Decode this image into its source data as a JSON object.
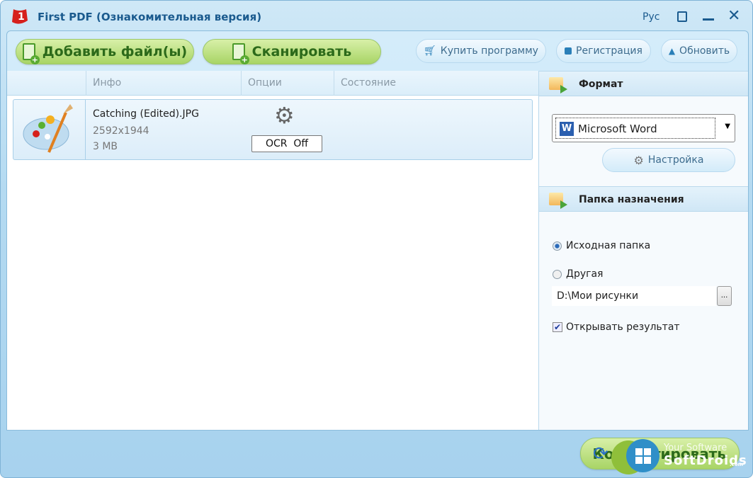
{
  "window": {
    "title": "First PDF (Ознакомительная версия)",
    "language": "Рус"
  },
  "toolbar": {
    "add_files": "Добавить файл(ы)",
    "scan": "Сканировать",
    "buy": "Купить программу",
    "register": "Регистрация",
    "update": "Обновить"
  },
  "list": {
    "columns": [
      "",
      "Инфо",
      "Опции",
      "Состояние"
    ],
    "files": [
      {
        "name": "Catching (Edited).JPG",
        "resolution": "2592x1944",
        "size": "3 MB",
        "ocr": "OCR  Off",
        "status": ""
      }
    ]
  },
  "format": {
    "header": "Формат",
    "selected": "Microsoft Word",
    "settings": "Настройка"
  },
  "destination": {
    "header": "Папка назначения",
    "source_folder": "Исходная папка",
    "other": "Другая",
    "path": "D:\\Мои рисунки",
    "browse": "...",
    "open_result": "Открывать результат",
    "selected": "source_folder",
    "open_result_checked": true
  },
  "convert": {
    "label": "Конвертировать"
  },
  "watermark": {
    "line1": "Your Software",
    "line2": "SoftDroids",
    ".com": ".com"
  }
}
